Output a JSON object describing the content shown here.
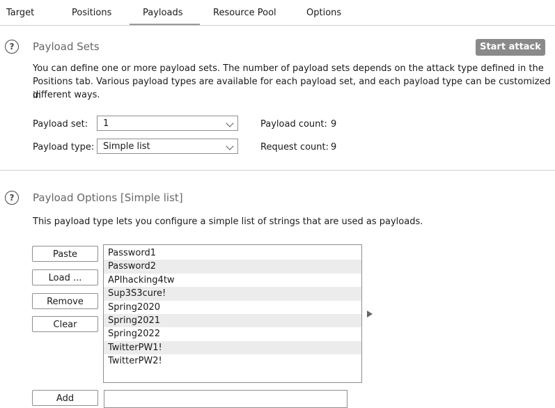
{
  "tabs": [
    "Target",
    "Positions",
    "Payloads",
    "Resource Pool",
    "Options"
  ],
  "active_tab": "Payloads",
  "payload_sets": {
    "title": "Payload Sets",
    "start_attack": "Start attack",
    "description_line1": "You can define one or more payload sets. The number of payload sets depends on the attack type defined in the",
    "description_line2": "Positions tab. Various payload types are available for each payload set, and each payload type can be customized in",
    "description_line3": "different ways.",
    "payload_set_label": "Payload set:",
    "payload_set_value": "1",
    "payload_type_label": "Payload type:",
    "payload_type_value": "Simple list",
    "payload_count_label": "Payload count:",
    "payload_count_value": "9",
    "request_count_label": "Request count:",
    "request_count_value": "9"
  },
  "payload_options": {
    "title": "Payload Options [Simple list]",
    "description": "This payload type lets you configure a simple list of strings that are used as payloads.",
    "buttons": {
      "paste": "Paste",
      "load": "Load ...",
      "remove": "Remove",
      "clear": "Clear",
      "add": "Add"
    },
    "items": [
      "Password1",
      "Password2",
      "APIhacking4tw",
      "Sup3S3cure!",
      "Spring2020",
      "Spring2021",
      "Spring2022",
      "TwitterPW1!",
      "TwitterPW2!"
    ],
    "add_value": ""
  },
  "icons": {
    "help": "help-circle-icon",
    "dropdown": "chevron-down-icon",
    "expand": "triangle-right-icon"
  },
  "colors": {
    "accent_button": "#8a8a8a",
    "row_alt": "#ececec"
  }
}
